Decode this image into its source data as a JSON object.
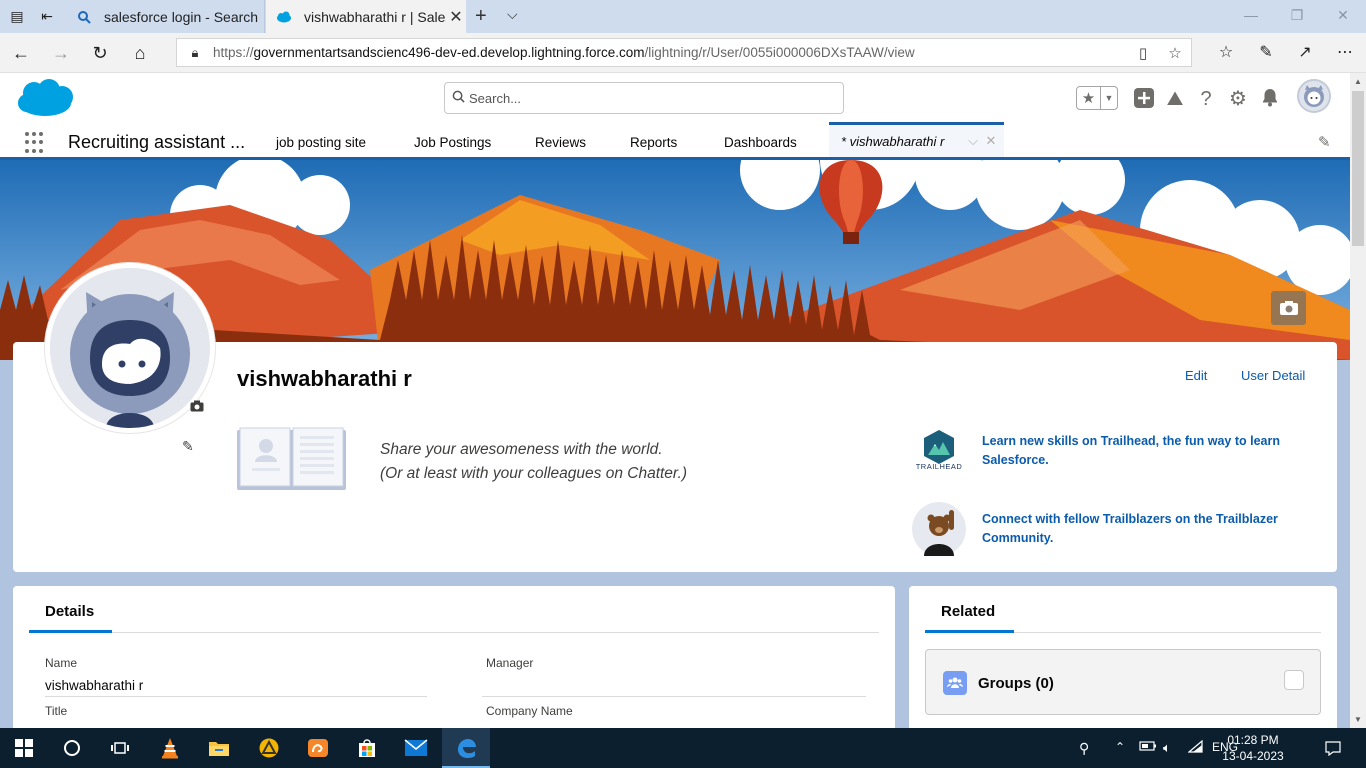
{
  "browser": {
    "tabs": [
      {
        "title": "salesforce login - Search"
      },
      {
        "title": "vishwabharathi r | Salesf"
      }
    ],
    "url_prefix": "https://",
    "url_host": "governmentartsandscienc496-dev-ed.develop.lightning.force.com",
    "url_path": "/lightning/r/User/0055i000006DXsTAAW/view"
  },
  "header": {
    "search_placeholder": "Search..."
  },
  "nav": {
    "app_name": "Recruiting assistant ...",
    "items": [
      "job posting site",
      "Job Postings",
      "Reviews",
      "Reports",
      "Dashboards"
    ],
    "active_tab": "* vishwabharathi r"
  },
  "profile": {
    "name": "vishwabharathi r",
    "edit_label": "Edit",
    "user_detail_label": "User Detail",
    "share_line1": "Share your awesomeness with the world.",
    "share_line2": "(Or at least with your colleagues on Chatter.)",
    "trailhead_caption": "TRAILHEAD",
    "promo1_line1": "Learn new skills on Trailhead, the fun way to learn",
    "promo1_line2": "Salesforce.",
    "promo2_line1": "Connect with fellow Trailblazers on the Trailblazer",
    "promo2_line2": "Community."
  },
  "details": {
    "tab_label": "Details",
    "name_label": "Name",
    "name_value": "vishwabharathi r",
    "manager_label": "Manager",
    "manager_value": "",
    "title_label": "Title",
    "company_label": "Company Name"
  },
  "related": {
    "tab_label": "Related",
    "groups_label": "Groups (0)"
  },
  "taskbar": {
    "language": "ENG",
    "time": "01:28 PM",
    "date": "13-04-2023"
  },
  "colors": {
    "brand_blue": "#0b5cab",
    "nav_accent": "#1b5fa6",
    "salesforce_cloud": "#00a1e0",
    "page_bg": "#b0c4df"
  }
}
